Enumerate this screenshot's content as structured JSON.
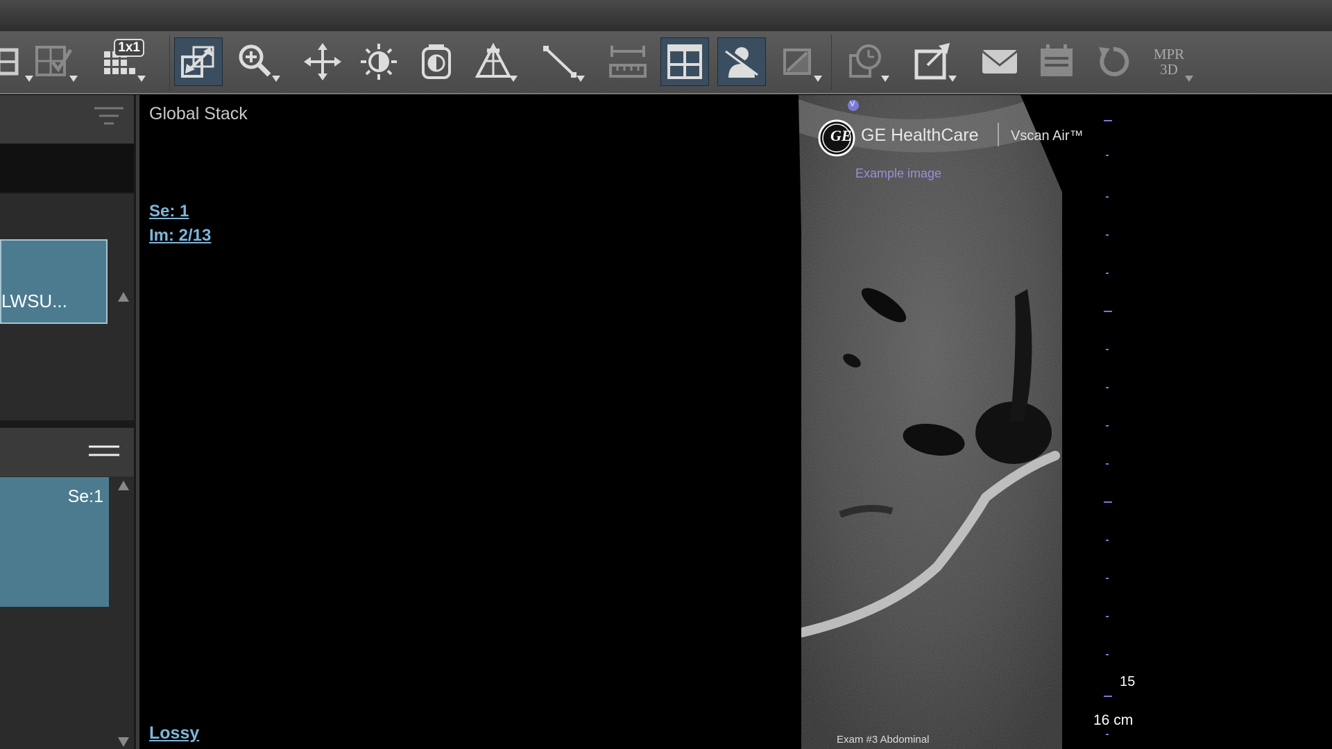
{
  "toolbar": {
    "tools": [
      {
        "name": "layout-tool",
        "icon": "layout-icon"
      },
      {
        "name": "select-series-tool",
        "icon": "checked-grid-icon"
      },
      {
        "name": "grid-layout-tool",
        "icon": "grid-icon",
        "badge": "1x1"
      },
      {
        "name": "scale-tool",
        "icon": "resize-arrows-icon",
        "active": true
      },
      {
        "name": "zoom-tool",
        "icon": "magnifier-icon"
      },
      {
        "name": "pan-tool",
        "icon": "move-arrows-icon"
      },
      {
        "name": "brightness-tool",
        "icon": "sun-icon"
      },
      {
        "name": "contrast-tool",
        "icon": "contrast-icon"
      },
      {
        "name": "window-level-tool",
        "icon": "triangle-mesh-icon"
      },
      {
        "name": "measure-line-tool",
        "icon": "line-icon"
      },
      {
        "name": "ruler-tool",
        "icon": "ruler-icon"
      },
      {
        "name": "tile-view-tool",
        "icon": "tile-window-icon",
        "active": true
      },
      {
        "name": "anonymize-tool",
        "icon": "hidden-person-icon",
        "active": true
      },
      {
        "name": "image-edit-tool",
        "icon": "image-edit-icon"
      },
      {
        "name": "timer-tool",
        "icon": "clock-stack-icon"
      },
      {
        "name": "export-tool",
        "icon": "export-icon"
      },
      {
        "name": "email-tool",
        "icon": "envelope-icon"
      },
      {
        "name": "calendar-tool",
        "icon": "calendar-icon"
      },
      {
        "name": "reset-tool",
        "icon": "reset-icon"
      },
      {
        "name": "mpr-3d-tool",
        "label_top": "MPR",
        "label_bottom": "3D"
      }
    ]
  },
  "sidebar": {
    "study_label": "LWSU...",
    "series_label": "Se:1"
  },
  "viewport": {
    "title": "Global Stack",
    "series": "Se: 1",
    "image": "Im: 2/13",
    "lossy": "Lossy"
  },
  "ultrasound": {
    "brand": "GE HealthCare",
    "product": "Vscan Air™",
    "example_label": "Example image",
    "orientation_marker": "V",
    "depth_tick_label": "15",
    "depth": "16 cm",
    "exam": "Exam #3  Abdominal"
  },
  "colors": {
    "accent_blue": "#7eb6d9",
    "card_teal": "#4c7b8f",
    "active_tool": "#3b4e60",
    "depth_marks": "#7a7ad6"
  }
}
